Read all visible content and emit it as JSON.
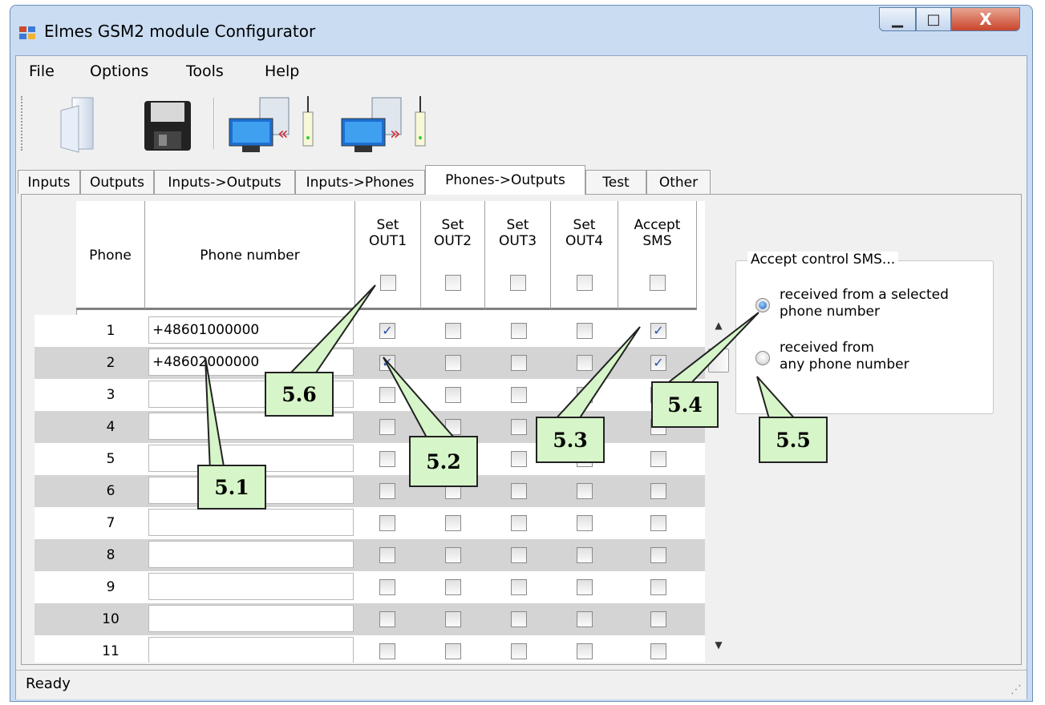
{
  "window": {
    "title": "Elmes GSM2 module Configurator",
    "controls": {
      "minimize": "▁",
      "maximize": "□",
      "close": "X"
    }
  },
  "menu": {
    "file": "File",
    "options": "Options",
    "tools": "Tools",
    "help": "Help"
  },
  "toolbar": {
    "open": "open-file-icon",
    "save": "save-disk-icon",
    "read": "read-from-module-icon",
    "write": "write-to-module-icon"
  },
  "tabs": {
    "inputs": "Inputs",
    "outputs": "Outputs",
    "inputs_outputs": "Inputs->Outputs",
    "inputs_phones": "Inputs->Phones",
    "phones_outputs": "Phones->Outputs",
    "test": "Test",
    "other": "Other",
    "active": "Phones->Outputs"
  },
  "grid": {
    "headers": {
      "phone": "Phone",
      "number": "Phone number",
      "out1": [
        "Set",
        "OUT1"
      ],
      "out2": [
        "Set",
        "OUT2"
      ],
      "out3": [
        "Set",
        "OUT3"
      ],
      "out4": [
        "Set",
        "OUT4"
      ],
      "sms": [
        "Accept",
        "SMS"
      ]
    },
    "rows": [
      {
        "idx": "1",
        "number": "+48601000000",
        "checks": [
          true,
          false,
          false,
          false,
          true
        ]
      },
      {
        "idx": "2",
        "number": "+48602000000",
        "checks": [
          true,
          false,
          false,
          false,
          true
        ]
      },
      {
        "idx": "3",
        "number": "",
        "checks": [
          false,
          false,
          false,
          false,
          false
        ]
      },
      {
        "idx": "4",
        "number": "",
        "checks": [
          false,
          false,
          false,
          false,
          false
        ]
      },
      {
        "idx": "5",
        "number": "",
        "checks": [
          false,
          false,
          false,
          false,
          false
        ]
      },
      {
        "idx": "6",
        "number": "",
        "checks": [
          false,
          false,
          false,
          false,
          false
        ]
      },
      {
        "idx": "7",
        "number": "",
        "checks": [
          false,
          false,
          false,
          false,
          false
        ]
      },
      {
        "idx": "8",
        "number": "",
        "checks": [
          false,
          false,
          false,
          false,
          false
        ]
      },
      {
        "idx": "9",
        "number": "",
        "checks": [
          false,
          false,
          false,
          false,
          false
        ]
      },
      {
        "idx": "10",
        "number": "",
        "checks": [
          false,
          false,
          false,
          false,
          false
        ]
      },
      {
        "idx": "11",
        "number": "",
        "checks": [
          false,
          false,
          false,
          false,
          false
        ]
      }
    ]
  },
  "sms_group": {
    "title": "Accept control SMS...",
    "option_selected": [
      "received from a selected",
      "phone number"
    ],
    "option_any": [
      "received from",
      "any phone number"
    ],
    "selected": "option_selected"
  },
  "status": {
    "text": "Ready"
  },
  "callouts": {
    "c51": "5.1",
    "c52": "5.2",
    "c53": "5.3",
    "c54": "5.4",
    "c55": "5.5",
    "c56": "5.6"
  },
  "colors": {
    "callout_fill": "#d6f5c8",
    "title_bar": "#c9dcf2",
    "alt_row": "#d4d4d4",
    "check": "#2b4fa3"
  }
}
